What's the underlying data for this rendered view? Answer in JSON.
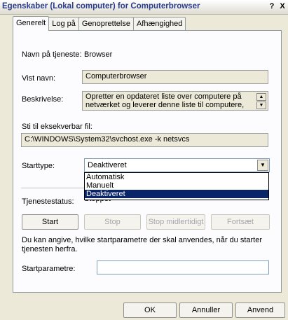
{
  "window": {
    "title": "Egenskaber (Lokal computer) for Computerbrowser",
    "help_glyph": "?",
    "close_glyph": "X"
  },
  "tabs": [
    {
      "label": "Generelt",
      "active": true
    },
    {
      "label": "Log på",
      "active": false
    },
    {
      "label": "Genoprettelse",
      "active": false
    },
    {
      "label": "Afhængighed",
      "active": false
    }
  ],
  "general": {
    "service_name_label": "Navn på tjeneste:",
    "service_name_value": "Browser",
    "display_name_label": "Vist navn:",
    "display_name_value": "Computerbrowser",
    "description_label": "Beskrivelse:",
    "description_value": "Opretter en opdateret liste over computere på netværket og leverer denne liste til computere, der er",
    "path_label": "Sti til eksekverbar fil:",
    "path_value": "C:\\WINDOWS\\System32\\svchost.exe -k netsvcs",
    "startup_type_label": "Starttype:",
    "startup_type_value": "Deaktiveret",
    "startup_options": [
      "Automatisk",
      "Manuelt",
      "Deaktiveret"
    ],
    "status_label": "Tjenestestatus:",
    "status_value": "Stoppet"
  },
  "service_buttons": {
    "start": "Start",
    "stop": "Stop",
    "pause": "Stop midlertidigt",
    "resume": "Fortsæt"
  },
  "start_params": {
    "hint": "Du kan angive, hvilke startparametre der skal anvendes, når du starter tjenesten herfra.",
    "label": "Startparametre:",
    "value": ""
  },
  "dialog_buttons": {
    "ok": "OK",
    "cancel": "Annuller",
    "apply": "Anvend"
  }
}
